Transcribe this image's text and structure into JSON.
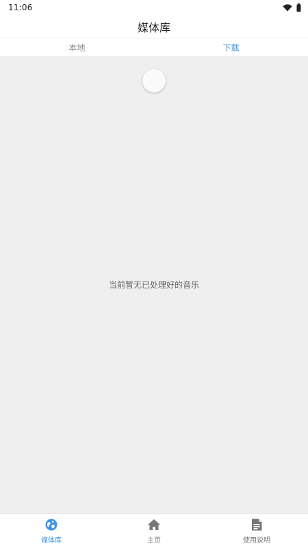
{
  "status_bar": {
    "time": "11:06",
    "icons": [
      "wifi-icon",
      "battery-icon"
    ]
  },
  "header": {
    "title": "媒体库"
  },
  "tabs": [
    {
      "label": "本地",
      "active": false
    },
    {
      "label": "下载",
      "active": true
    }
  ],
  "main": {
    "empty_message": "当前暂无已处理好的音乐"
  },
  "bottom_nav": {
    "items": [
      {
        "label": "媒体库",
        "icon": "media-library-icon",
        "active": true
      },
      {
        "label": "主页",
        "icon": "home-icon",
        "active": false
      },
      {
        "label": "使用说明",
        "icon": "document-icon",
        "active": false
      }
    ]
  },
  "colors": {
    "accent": "#3f96e6",
    "inactive": "#777777",
    "content_background": "#efefef"
  }
}
